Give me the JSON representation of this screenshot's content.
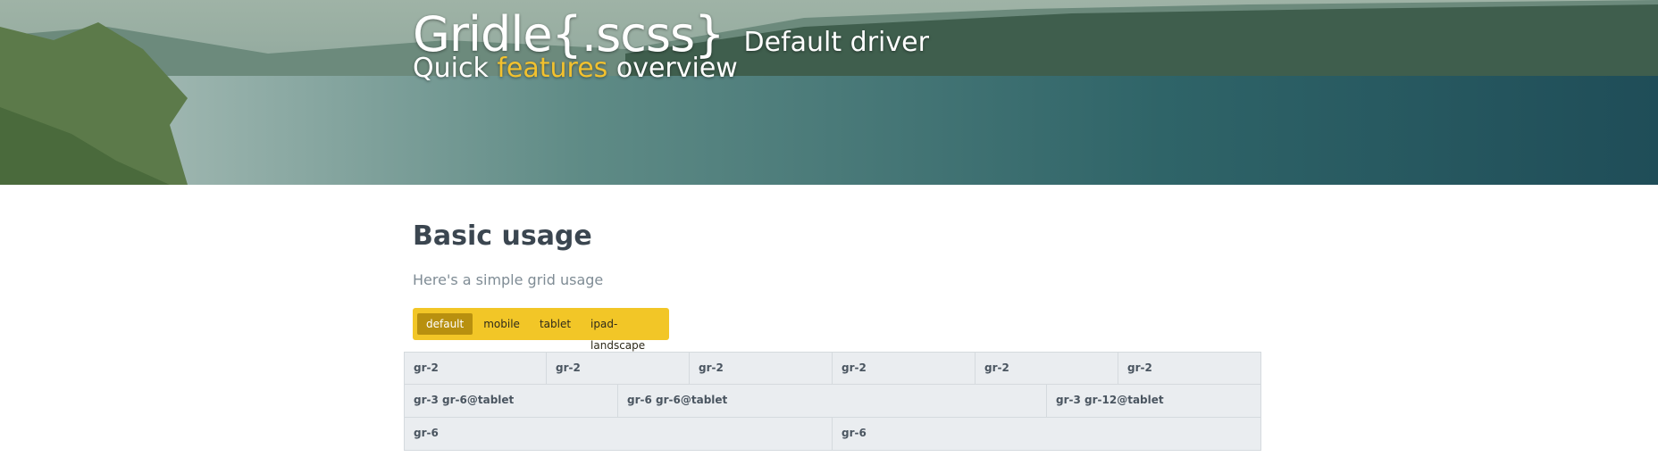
{
  "hero": {
    "brand": "Gridle{.scss}",
    "driver": "Default driver",
    "subtitle_pre": "Quick ",
    "subtitle_highlight": "features",
    "subtitle_post": " overview"
  },
  "main": {
    "heading": "Basic usage",
    "lead": "Here's a simple grid usage"
  },
  "tabs": [
    {
      "label": "default",
      "active": true
    },
    {
      "label": "mobile",
      "active": false
    },
    {
      "label": "tablet",
      "active": false
    },
    {
      "label": "ipad-landscape",
      "active": false
    }
  ],
  "grid": {
    "row1": [
      "gr-2",
      "gr-2",
      "gr-2",
      "gr-2",
      "gr-2",
      "gr-2"
    ],
    "row2": [
      "gr-3 gr-6@tablet",
      "gr-6 gr-6@tablet",
      "gr-3 gr-12@tablet"
    ],
    "row3": [
      "gr-6",
      "gr-6"
    ]
  },
  "colors": {
    "accent": "#f2c627",
    "accent_active": "#b8900f",
    "highlight_text": "#f2c12e",
    "cell_bg": "#eaedf0"
  }
}
